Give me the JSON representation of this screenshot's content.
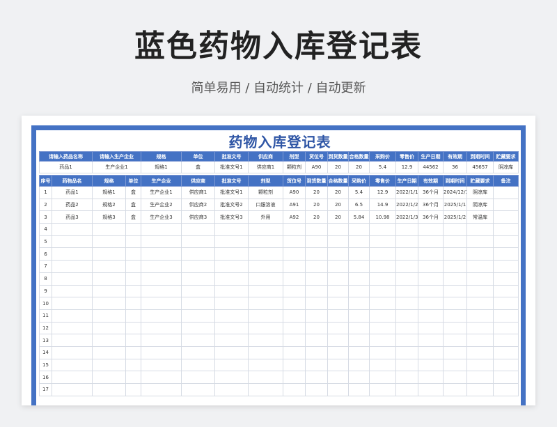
{
  "hero": {
    "title": "蓝色药物入库登记表",
    "subtitle": "简单易用  /  自动统计  /  自动更新"
  },
  "sheet": {
    "title": "药物入库登记表",
    "query_headers": [
      "请输入药品名称",
      "请输入生产企业",
      "规格",
      "单位",
      "批准文号",
      "供应商",
      "剂型",
      "货位号",
      "到货数量",
      "合格数量",
      "采购价",
      "零售价",
      "生产日期",
      "有效期",
      "到期时间",
      "贮藏要求"
    ],
    "query_values": [
      "药品1",
      "生产企业1",
      "规格1",
      "盒",
      "批准文号1",
      "供应商1",
      "颗粒剂",
      "A90",
      "20",
      "20",
      "5.4",
      "12.9",
      "44562",
      "36",
      "45657",
      "阴凉库"
    ],
    "columns": [
      "序号",
      "药物品名",
      "规格",
      "单位",
      "生产企业",
      "供应商",
      "批准文号",
      "剂型",
      "货位号",
      "到货数量",
      "合格数量",
      "采购价",
      "零售价",
      "生产日期",
      "有效期",
      "到期时间",
      "贮藏要求",
      "备注"
    ],
    "rows": [
      [
        "1",
        "药品1",
        "规格1",
        "盒",
        "生产企业1",
        "供应商1",
        "批准文号1",
        "颗粒剂",
        "A90",
        "20",
        "20",
        "5.4",
        "12.9",
        "2022/1/1",
        "36个月",
        "2024/12/31",
        "阴凉库",
        ""
      ],
      [
        "2",
        "药品2",
        "规格2",
        "盒",
        "生产企业2",
        "供应商2",
        "批准文号2",
        "口服溶液",
        "A91",
        "20",
        "20",
        "6.5",
        "14.9",
        "2022/1/2",
        "36个月",
        "2025/1/1",
        "阴凉库",
        ""
      ],
      [
        "3",
        "药品3",
        "规格3",
        "盒",
        "生产企业3",
        "供应商3",
        "批准文号3",
        "外用",
        "A92",
        "20",
        "20",
        "5.84",
        "10.98",
        "2022/1/3",
        "36个月",
        "2025/1/2",
        "常温库",
        ""
      ],
      [
        "4",
        "",
        "",
        "",
        "",
        "",
        "",
        "",
        "",
        "",
        "",
        "",
        "",
        "",
        "",
        "",
        "",
        ""
      ],
      [
        "5",
        "",
        "",
        "",
        "",
        "",
        "",
        "",
        "",
        "",
        "",
        "",
        "",
        "",
        "",
        "",
        "",
        ""
      ],
      [
        "6",
        "",
        "",
        "",
        "",
        "",
        "",
        "",
        "",
        "",
        "",
        "",
        "",
        "",
        "",
        "",
        "",
        ""
      ],
      [
        "7",
        "",
        "",
        "",
        "",
        "",
        "",
        "",
        "",
        "",
        "",
        "",
        "",
        "",
        "",
        "",
        "",
        ""
      ],
      [
        "8",
        "",
        "",
        "",
        "",
        "",
        "",
        "",
        "",
        "",
        "",
        "",
        "",
        "",
        "",
        "",
        "",
        ""
      ],
      [
        "9",
        "",
        "",
        "",
        "",
        "",
        "",
        "",
        "",
        "",
        "",
        "",
        "",
        "",
        "",
        "",
        "",
        ""
      ],
      [
        "10",
        "",
        "",
        "",
        "",
        "",
        "",
        "",
        "",
        "",
        "",
        "",
        "",
        "",
        "",
        "",
        "",
        ""
      ],
      [
        "11",
        "",
        "",
        "",
        "",
        "",
        "",
        "",
        "",
        "",
        "",
        "",
        "",
        "",
        "",
        "",
        "",
        ""
      ],
      [
        "12",
        "",
        "",
        "",
        "",
        "",
        "",
        "",
        "",
        "",
        "",
        "",
        "",
        "",
        "",
        "",
        "",
        ""
      ],
      [
        "13",
        "",
        "",
        "",
        "",
        "",
        "",
        "",
        "",
        "",
        "",
        "",
        "",
        "",
        "",
        "",
        "",
        ""
      ],
      [
        "14",
        "",
        "",
        "",
        "",
        "",
        "",
        "",
        "",
        "",
        "",
        "",
        "",
        "",
        "",
        "",
        "",
        ""
      ],
      [
        "15",
        "",
        "",
        "",
        "",
        "",
        "",
        "",
        "",
        "",
        "",
        "",
        "",
        "",
        "",
        "",
        "",
        ""
      ],
      [
        "16",
        "",
        "",
        "",
        "",
        "",
        "",
        "",
        "",
        "",
        "",
        "",
        "",
        "",
        "",
        "",
        "",
        ""
      ],
      [
        "17",
        "",
        "",
        "",
        "",
        "",
        "",
        "",
        "",
        "",
        "",
        "",
        "",
        "",
        "",
        "",
        "",
        ""
      ]
    ]
  },
  "colors": {
    "accent": "#4472c4",
    "title_blue": "#2e55a5"
  }
}
